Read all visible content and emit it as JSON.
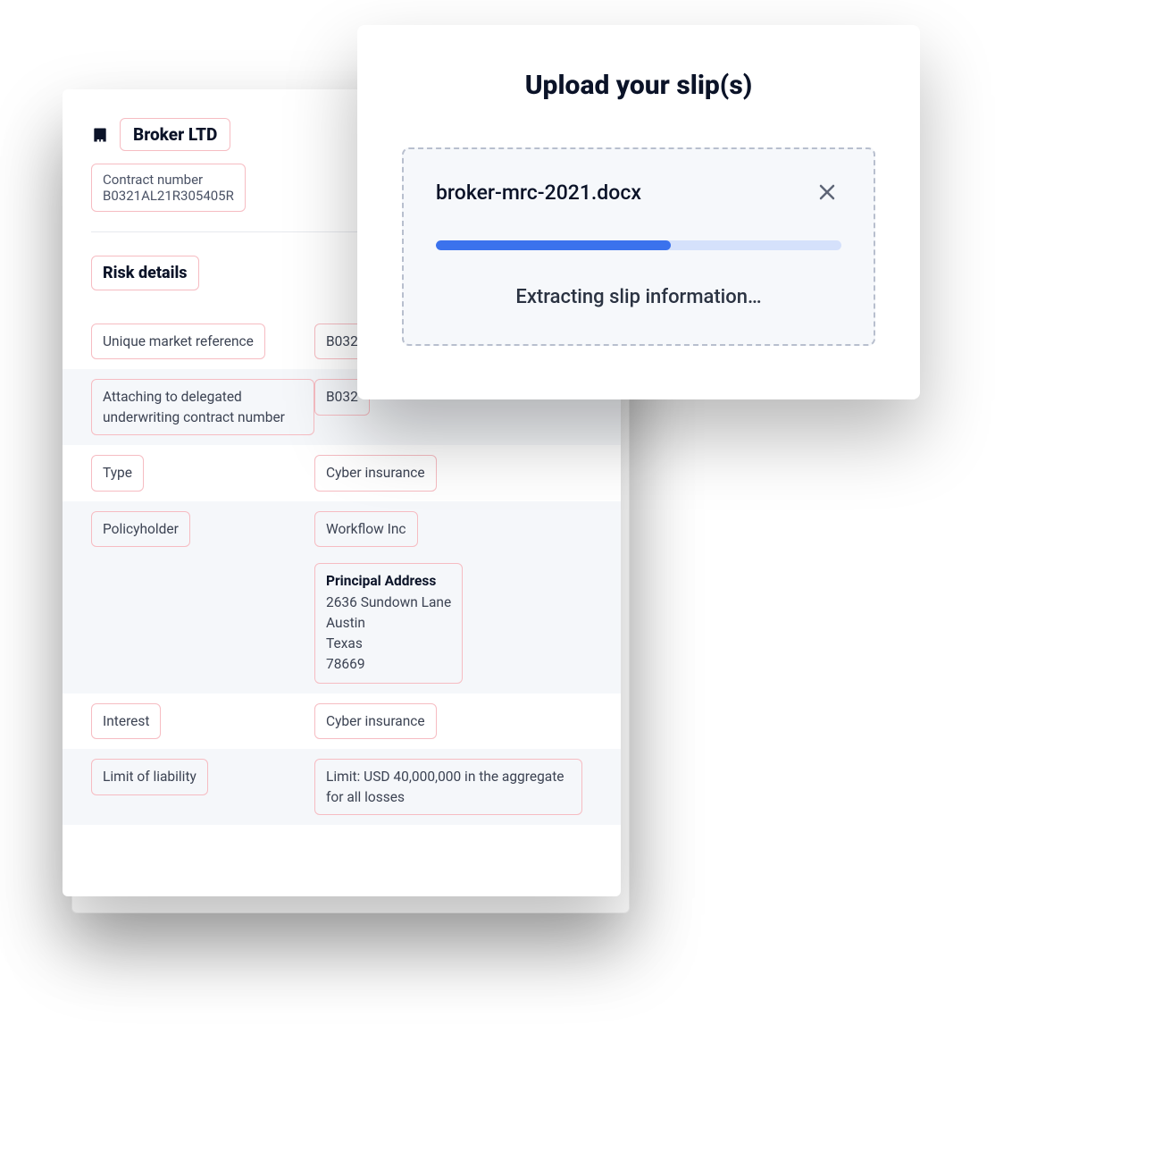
{
  "upload": {
    "title": "Upload your slip(s)",
    "file_name": "broker-mrc-2021.docx",
    "status": "Extracting slip information…",
    "progress_percent": 58
  },
  "details": {
    "broker_name": "Broker LTD",
    "contract_number_label": "Contract number",
    "contract_number_value": "B0321AL21R305405R",
    "section_title": "Risk details",
    "rows": [
      {
        "label": "Unique market reference",
        "value": "B032",
        "shaded": false
      },
      {
        "label": "Attaching to delegated underwriting contract number",
        "value": "B032",
        "shaded": true
      },
      {
        "label": "Type",
        "value": "Cyber insurance",
        "shaded": false
      },
      {
        "label": "Policyholder",
        "value": "Workflow Inc",
        "shaded": true,
        "address": {
          "title": "Principal Address",
          "lines": [
            "2636 Sundown Lane",
            "Austin",
            "Texas",
            "78669"
          ]
        }
      },
      {
        "label": "Interest",
        "value": "Cyber insurance",
        "shaded": false
      },
      {
        "label": "Limit of liability",
        "value": "Limit: USD 40,000,000 in the aggregate for all losses",
        "shaded": true
      }
    ]
  },
  "colors": {
    "chip_border": "#f6bcc2",
    "progress_fill": "#3b72ed",
    "progress_track": "#d5e1fb"
  }
}
